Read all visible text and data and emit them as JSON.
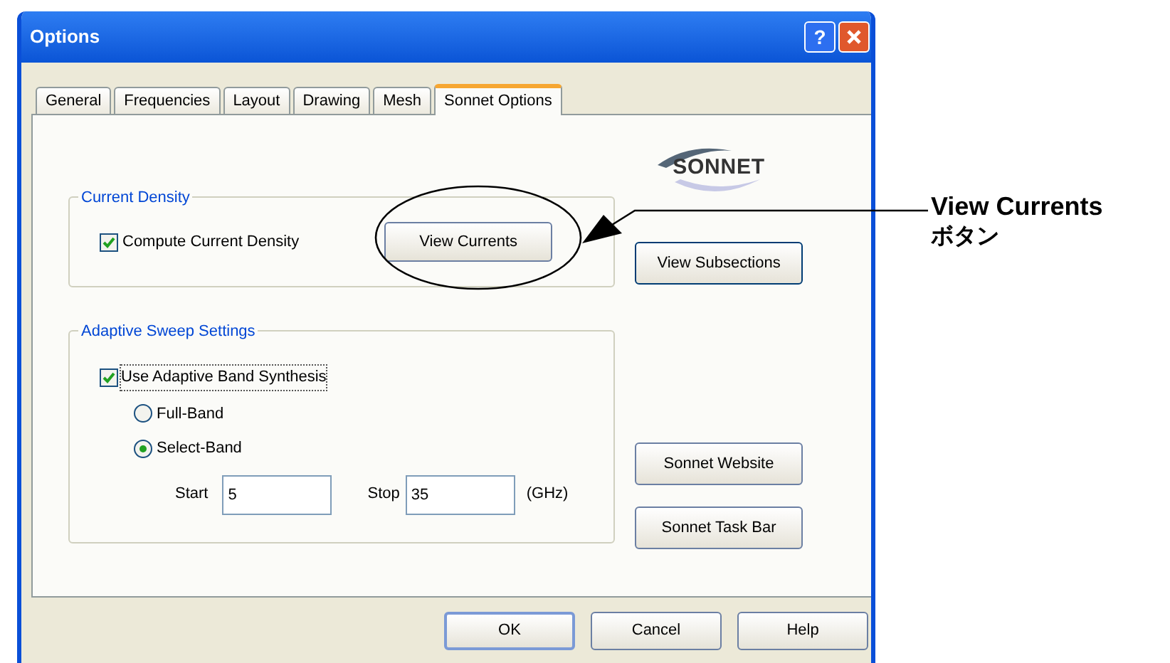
{
  "dialog": {
    "title": "Options",
    "help_glyph": "?",
    "tabs": [
      {
        "label": "General",
        "selected": false
      },
      {
        "label": "Frequencies",
        "selected": false
      },
      {
        "label": "Layout",
        "selected": false
      },
      {
        "label": "Drawing",
        "selected": false
      },
      {
        "label": "Mesh",
        "selected": false
      },
      {
        "label": "Sonnet Options",
        "selected": true
      }
    ],
    "logo": "SONNET",
    "current_density": {
      "title": "Current Density",
      "checkbox": {
        "label": "Compute Current Density",
        "checked": true
      },
      "button": "View Currents"
    },
    "view_subsections_button": "View Subsections",
    "adaptive_sweep": {
      "title": "Adaptive Sweep Settings",
      "checkbox": {
        "label": "Use Adaptive Band Synthesis",
        "checked": true
      },
      "bands": [
        {
          "label": "Full-Band",
          "selected": false
        },
        {
          "label": "Select-Band",
          "selected": true
        }
      ],
      "start": {
        "label": "Start",
        "value": "5"
      },
      "stop": {
        "label": "Stop",
        "value": "35"
      },
      "unit": "(GHz)"
    },
    "side_buttons": [
      "Sonnet Website",
      "Sonnet Task Bar"
    ],
    "buttons": [
      "OK",
      "Cancel",
      "Help"
    ]
  },
  "callout": {
    "lines": [
      "View Currents",
      "ボタン"
    ]
  }
}
